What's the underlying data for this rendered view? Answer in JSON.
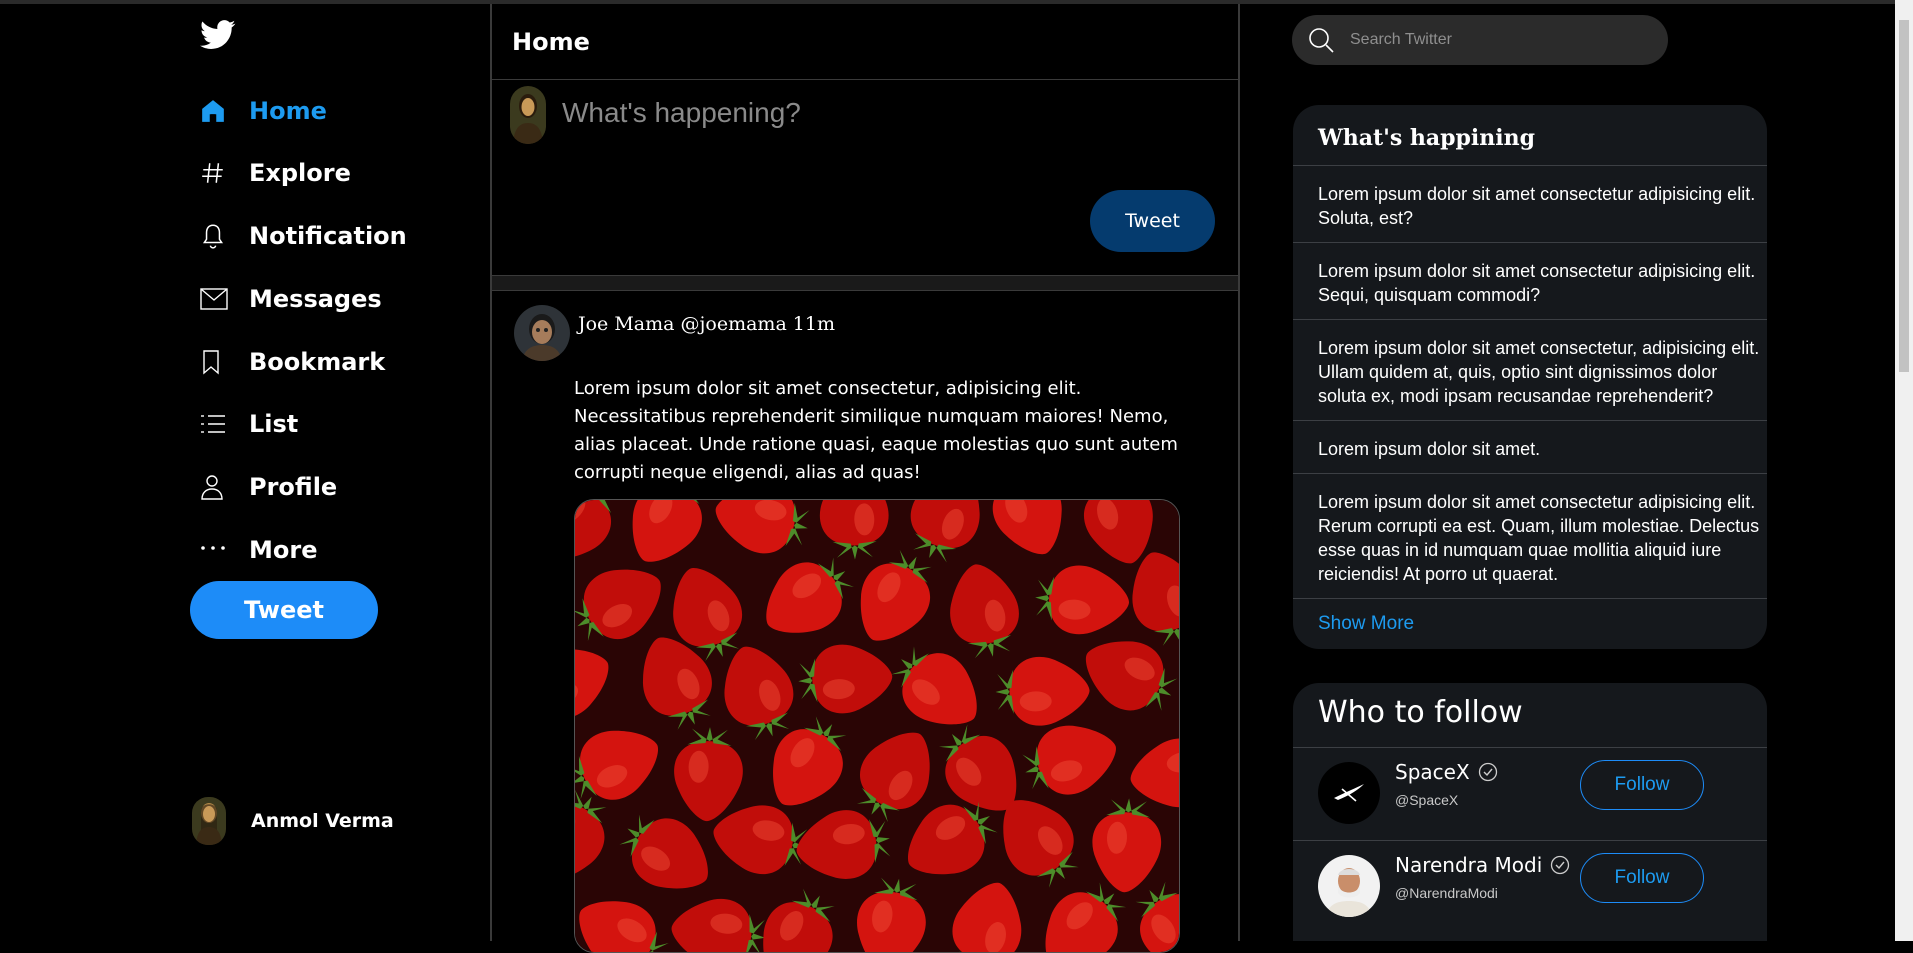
{
  "sidebar": {
    "nav": [
      {
        "label": "Home",
        "icon": "home-icon",
        "active": true
      },
      {
        "label": "Explore",
        "icon": "hashtag-icon"
      },
      {
        "label": "Notification",
        "icon": "bell-icon"
      },
      {
        "label": "Messages",
        "icon": "mail-icon"
      },
      {
        "label": "Bookmark",
        "icon": "bookmark-icon"
      },
      {
        "label": "List",
        "icon": "list-icon"
      },
      {
        "label": "Profile",
        "icon": "person-icon"
      },
      {
        "label": "More",
        "icon": "more-icon"
      }
    ],
    "tweet_button": "Tweet",
    "user_name": "Anmol Verma"
  },
  "feed": {
    "title": "Home",
    "compose_placeholder": "What's happening?",
    "compose_button": "Tweet",
    "post": {
      "meta": "Joe Mama @joemama 11m",
      "text": "Lorem ipsum dolor sit amet consectetur, adipisicing elit. Necessitatibus reprehenderit similique numquam maiores! Nemo, alias placeat. Unde ratione quasi, eaque molestias quo sunt autem corrupti neque eligendi, alias ad quas!"
    }
  },
  "right": {
    "search_placeholder": "Search Twitter",
    "trends_title": "What's happining",
    "trends": [
      "Lorem ipsum dolor sit amet consectetur adipisicing elit. Soluta, est?",
      "Lorem ipsum dolor sit amet consectetur adipisicing elit. Sequi, quisquam commodi?",
      "Lorem ipsum dolor sit amet consectetur, adipisicing elit. Ullam quidem at, quis, optio sint dignissimos dolor soluta ex, modi ipsam recusandae reprehenderit?",
      "Lorem ipsum dolor sit amet.",
      "Lorem ipsum dolor sit amet consectetur adipisicing elit. Rerum corrupti ea est. Quam, illum molestiae. Delectus esse quas in id numquam quae mollitia aliquid iure reiciendis! At porro ut quaerat."
    ],
    "show_more": "Show More",
    "follow_title": "Who to follow",
    "follow": [
      {
        "name": "SpaceX",
        "handle": "@SpaceX",
        "button": "Follow"
      },
      {
        "name": "Narendra Modi",
        "handle": "@NarendraModi",
        "button": "Follow"
      }
    ]
  },
  "colors": {
    "accent": "#1d9bf0",
    "tweet_button": "#1d8cf8",
    "compose_button": "#053b6e",
    "panel": "#15181c"
  }
}
